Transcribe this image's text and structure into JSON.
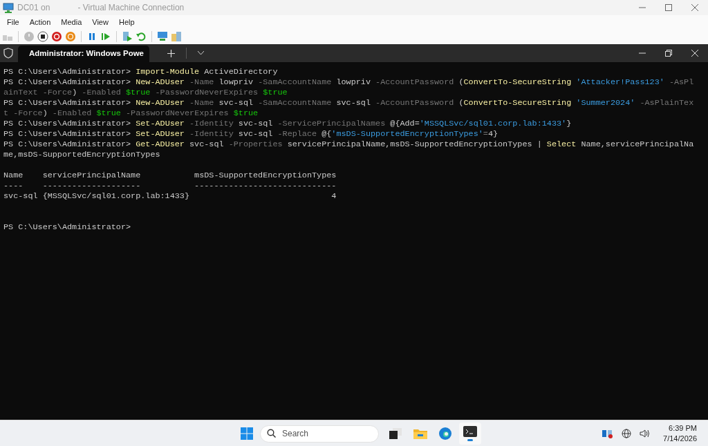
{
  "window": {
    "title_left": "DC01 on",
    "title_right": "- Virtual Machine Connection"
  },
  "menu": [
    "File",
    "Action",
    "Media",
    "View",
    "Help"
  ],
  "terminal": {
    "tab": {
      "title": "Administrator: Windows Powe",
      "selected": true
    },
    "lines": [
      {
        "kind": "text",
        "spans": [
          {
            "kind": "prompt",
            "text": "PS C:\\Users\\Administrator> "
          },
          {
            "kind": "cmd",
            "text": "Import-Module"
          },
          {
            "kind": "plain",
            "text": " ActiveDirectory"
          }
        ]
      },
      {
        "kind": "text",
        "spans": [
          {
            "kind": "prompt",
            "text": "PS C:\\Users\\Administrator> "
          },
          {
            "kind": "cmd",
            "text": "New-ADUser"
          },
          {
            "kind": "param",
            "text": " -Name"
          },
          {
            "kind": "plain",
            "text": " lowpriv"
          },
          {
            "kind": "param",
            "text": " -SamAccountName"
          },
          {
            "kind": "plain",
            "text": " lowpriv"
          },
          {
            "kind": "param",
            "text": " -AccountPassword"
          },
          {
            "kind": "plain",
            "text": " ("
          },
          {
            "kind": "cmd",
            "text": "ConvertTo-SecureString"
          },
          {
            "kind": "str",
            "text": " 'Attacker!Pass123'"
          },
          {
            "kind": "param",
            "text": " -AsPl"
          }
        ]
      },
      {
        "kind": "text",
        "spans": [
          {
            "kind": "param",
            "text": "ainText -Force"
          },
          {
            "kind": "plain",
            "text": ")"
          },
          {
            "kind": "param",
            "text": " -Enabled"
          },
          {
            "kind": "var",
            "text": " $true"
          },
          {
            "kind": "param",
            "text": " -PasswordNeverExpires"
          },
          {
            "kind": "var",
            "text": " $true"
          }
        ]
      },
      {
        "kind": "text",
        "spans": [
          {
            "kind": "prompt",
            "text": "PS C:\\Users\\Administrator> "
          },
          {
            "kind": "cmd",
            "text": "New-ADUser"
          },
          {
            "kind": "param",
            "text": " -Name"
          },
          {
            "kind": "plain",
            "text": " svc-sql"
          },
          {
            "kind": "param",
            "text": " -SamAccountName"
          },
          {
            "kind": "plain",
            "text": " svc-sql"
          },
          {
            "kind": "param",
            "text": " -AccountPassword"
          },
          {
            "kind": "plain",
            "text": " ("
          },
          {
            "kind": "cmd",
            "text": "ConvertTo-SecureString"
          },
          {
            "kind": "str",
            "text": " 'Summer2024'"
          },
          {
            "kind": "param",
            "text": " -AsPlainTex"
          }
        ]
      },
      {
        "kind": "text",
        "spans": [
          {
            "kind": "param",
            "text": "t -Force"
          },
          {
            "kind": "plain",
            "text": ")"
          },
          {
            "kind": "param",
            "text": " -Enabled"
          },
          {
            "kind": "var",
            "text": " $true"
          },
          {
            "kind": "param",
            "text": " -PasswordNeverExpires"
          },
          {
            "kind": "var",
            "text": " $true"
          }
        ]
      },
      {
        "kind": "text",
        "spans": [
          {
            "kind": "prompt",
            "text": "PS C:\\Users\\Administrator> "
          },
          {
            "kind": "cmd",
            "text": "Set-ADUser"
          },
          {
            "kind": "param",
            "text": " -Identity"
          },
          {
            "kind": "plain",
            "text": " svc-sql"
          },
          {
            "kind": "param",
            "text": " -ServicePrincipalNames"
          },
          {
            "kind": "plain",
            "text": " @{Add="
          },
          {
            "kind": "str",
            "text": "'MSSQLSvc/sql01.corp.lab:1433'"
          },
          {
            "kind": "plain",
            "text": "}"
          }
        ]
      },
      {
        "kind": "text",
        "spans": [
          {
            "kind": "prompt",
            "text": "PS C:\\Users\\Administrator> "
          },
          {
            "kind": "cmd",
            "text": "Set-ADUser"
          },
          {
            "kind": "param",
            "text": " -Identity"
          },
          {
            "kind": "plain",
            "text": " svc-sql"
          },
          {
            "kind": "param",
            "text": " -Replace"
          },
          {
            "kind": "plain",
            "text": " @{"
          },
          {
            "kind": "str",
            "text": "'msDS-SupportedEncryptionTypes'"
          },
          {
            "kind": "param",
            "text": "="
          },
          {
            "kind": "plain",
            "text": "4}"
          }
        ]
      },
      {
        "kind": "text",
        "spans": [
          {
            "kind": "prompt",
            "text": "PS C:\\Users\\Administrator> "
          },
          {
            "kind": "cmd",
            "text": "Get-ADUser"
          },
          {
            "kind": "plain",
            "text": " svc-sql"
          },
          {
            "kind": "param",
            "text": " -Properties"
          },
          {
            "kind": "plain",
            "text": " servicePrincipalName,msDS-SupportedEncryptionTypes | "
          },
          {
            "kind": "cmd",
            "text": "Select"
          },
          {
            "kind": "plain",
            "text": " Name,servicePrincipalNa"
          }
        ]
      },
      {
        "kind": "text",
        "spans": [
          {
            "kind": "plain",
            "text": "me,msDS-SupportedEncryptionTypes"
          }
        ]
      },
      {
        "kind": "blank"
      },
      {
        "kind": "text",
        "spans": [
          {
            "kind": "plain",
            "text": "Name    servicePrincipalName           msDS-SupportedEncryptionTypes"
          }
        ]
      },
      {
        "kind": "text",
        "spans": [
          {
            "kind": "plain",
            "text": "----    --------------------           -----------------------------"
          }
        ]
      },
      {
        "kind": "text",
        "spans": [
          {
            "kind": "plain",
            "text": "svc-sql {MSSQLSvc/sql01.corp.lab:1433}                             4"
          }
        ]
      },
      {
        "kind": "blank"
      },
      {
        "kind": "blank"
      },
      {
        "kind": "text",
        "spans": [
          {
            "kind": "prompt",
            "text": "PS C:\\Users\\Administrator>"
          }
        ]
      }
    ]
  },
  "taskbar": {
    "search": {
      "placeholder": "Search"
    },
    "time": "6:39 PM",
    "date": "7/14/2026"
  }
}
